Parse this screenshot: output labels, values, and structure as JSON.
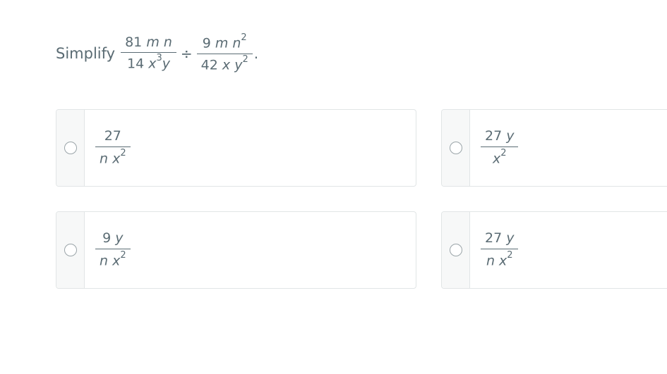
{
  "question": {
    "prompt": "Simplify",
    "first_fraction": {
      "num_coef": "81",
      "num_vars": "m n",
      "den_coef": "14",
      "den_var1": "x",
      "den_exp1": "3",
      "den_var2": "y"
    },
    "operator": "÷",
    "second_fraction": {
      "num_coef": "9",
      "num_vars": "m n",
      "num_exp": "2",
      "den_coef": "42",
      "den_vars": "x y",
      "den_exp": "2"
    },
    "end_mark": "."
  },
  "options": [
    {
      "num_coef": "27",
      "num_var": "",
      "den_var": "n x",
      "den_exp": "2"
    },
    {
      "num_coef": "27",
      "num_var": "y",
      "den_var": "x",
      "den_exp": "2"
    },
    {
      "num_coef": "9",
      "num_var": "y",
      "den_var": "n x",
      "den_exp": "2"
    },
    {
      "num_coef": "27",
      "num_var": "y",
      "den_var": "n x",
      "den_exp": "2"
    }
  ]
}
